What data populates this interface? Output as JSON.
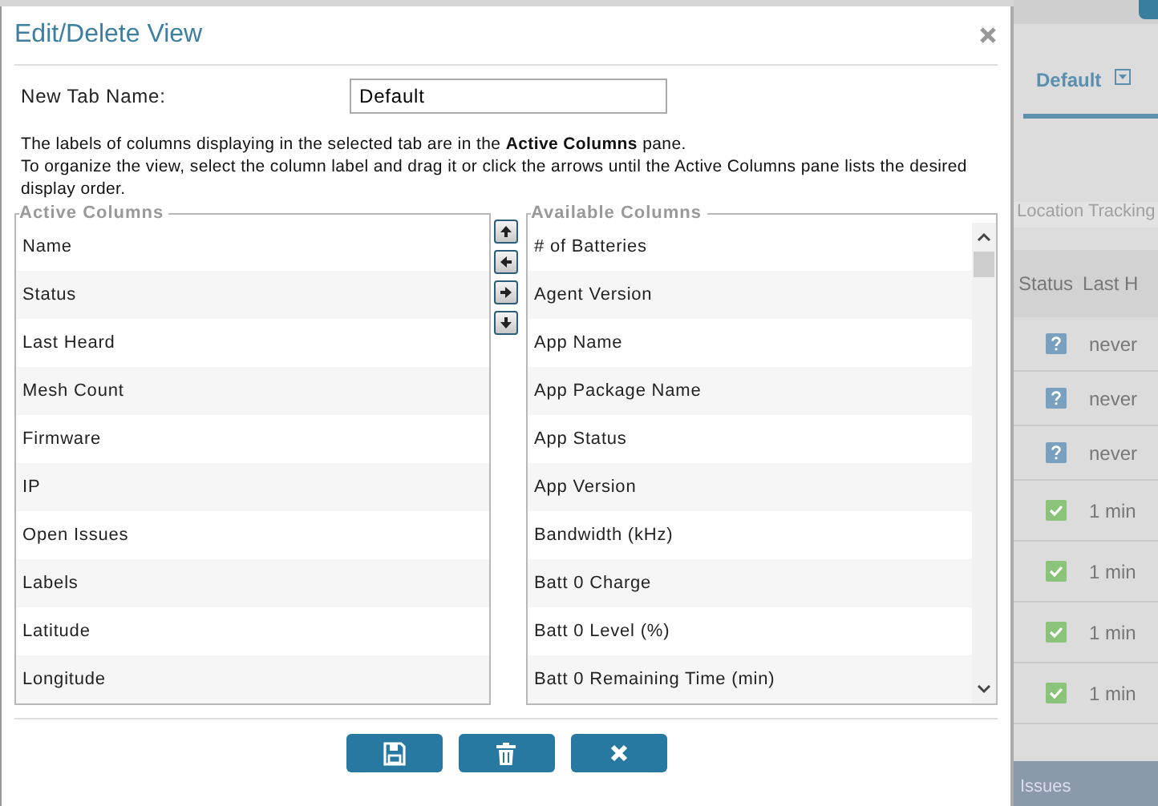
{
  "dialog": {
    "title": "Edit/Delete View",
    "tab_name": {
      "label": "New Tab Name:",
      "value": "Default"
    },
    "instructions": [
      "The labels of columns displaying in the selected tab are in the **Active Columns** pane.",
      "To organize the view, select the column label and drag it or click the arrows until the Active Columns pane lists the desired display order."
    ],
    "active_columns": {
      "legend": "Active Columns",
      "items": [
        "Name",
        "Status",
        "Last Heard",
        "Mesh Count",
        "Firmware",
        "IP",
        "Open Issues",
        "Labels",
        "Latitude",
        "Longitude"
      ]
    },
    "available_columns": {
      "legend": "Available Columns",
      "items": [
        "# of Batteries",
        "Agent Version",
        "App Name",
        "App Package Name",
        "App Status",
        "App Version",
        "Bandwidth (kHz)",
        "Batt 0 Charge",
        "Batt 0 Level (%)",
        "Batt 0 Remaining Time (min)"
      ]
    }
  },
  "background": {
    "tab": {
      "label": "Default"
    },
    "section": "Location Tracking",
    "table": {
      "columns": [
        "Status",
        "Last H"
      ],
      "rows": [
        {
          "kind": "unknown",
          "last_heard": "never"
        },
        {
          "kind": "unknown",
          "last_heard": "never"
        },
        {
          "kind": "unknown",
          "last_heard": "never"
        },
        {
          "kind": "ok",
          "last_heard": "1 min"
        },
        {
          "kind": "ok",
          "last_heard": "1 min"
        },
        {
          "kind": "ok",
          "last_heard": "1 min"
        },
        {
          "kind": "ok",
          "last_heard": "1 min"
        }
      ]
    },
    "footer": "Issues"
  }
}
